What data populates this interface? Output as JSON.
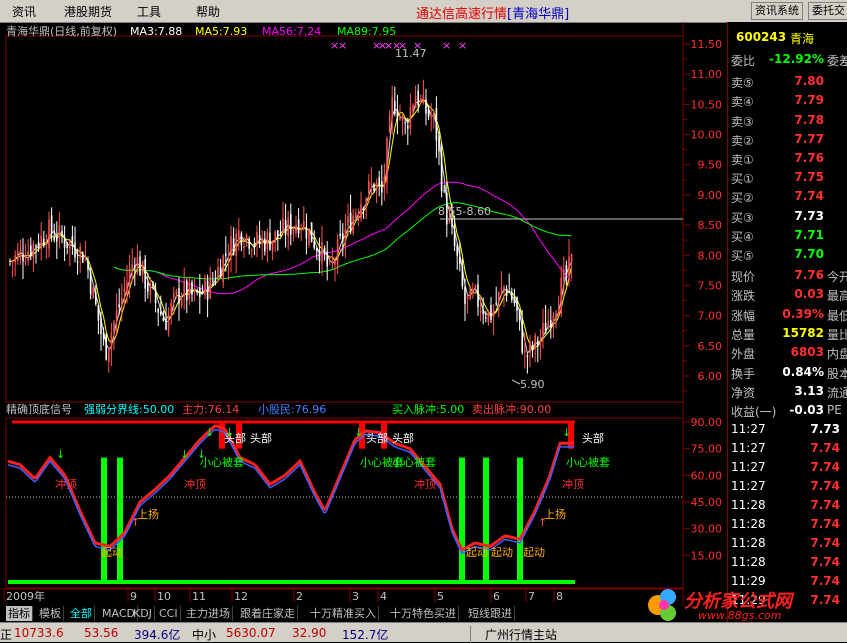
{
  "menu": {
    "items": [
      "资讯",
      "港股期货",
      "工具",
      "帮助"
    ],
    "title": "通达信高速行情",
    "title_stock": "[青海华鼎]",
    "buttons": [
      "资讯系统",
      "委托交"
    ]
  },
  "main_chart": {
    "legend": {
      "name": "青海华鼎(日线,前复权)",
      "ma3": "MA3:7.88",
      "ma5": "MA5:7.93",
      "ma56": "MA56:7.24",
      "ma89": "MA89:7.95"
    },
    "y_ticks": [
      "11.50",
      "11.00",
      "10.50",
      "10.00",
      "9.50",
      "9.00",
      "8.50",
      "8.00",
      "7.50",
      "7.00",
      "6.50",
      "6.00"
    ],
    "annotations": {
      "high": "11.47",
      "low": "5.90",
      "range": "8.55-8.60"
    },
    "colors": {
      "up": "#ff5050",
      "down": "#ffffff",
      "ma3": "#ffffff",
      "ma5": "#ffff00",
      "ma56": "#ff00ff",
      "ma89": "#00ff00"
    }
  },
  "indicator": {
    "legend": {
      "name": "精确顶底信号",
      "strength": "强弱分界线:50.00",
      "main_force": "主力:76.14",
      "retail": "小股民:76.96",
      "buy_pulse": "买入脉冲:5.00",
      "sell_pulse": "卖出脉冲:90.00"
    },
    "y_ticks": [
      "90.00",
      "75.00",
      "60.00",
      "45.00",
      "30.00",
      "15.00"
    ],
    "labels": {
      "top": "头部",
      "caution": "小心被套",
      "rush": "冲顶",
      "rise": "上扬",
      "start": "起动"
    }
  },
  "x_axis": [
    "2009年",
    "9",
    "10",
    "11",
    "12",
    "2",
    "3",
    "4",
    "5",
    "6",
    "7",
    "8"
  ],
  "quote": {
    "code": "600243",
    "name": "青海",
    "ratio_label": "委比",
    "ratio": "-12.92%",
    "ratio_extra": "委差",
    "asks": [
      {
        "label": "卖⑤",
        "price": "7.80"
      },
      {
        "label": "卖④",
        "price": "7.79"
      },
      {
        "label": "卖③",
        "price": "7.78"
      },
      {
        "label": "卖②",
        "price": "7.77"
      },
      {
        "label": "卖①",
        "price": "7.76"
      }
    ],
    "bids": [
      {
        "label": "买①",
        "price": "7.75"
      },
      {
        "label": "买②",
        "price": "7.74"
      },
      {
        "label": "买③",
        "price": "7.73"
      },
      {
        "label": "买④",
        "price": "7.71"
      },
      {
        "label": "买⑤",
        "price": "7.70"
      }
    ],
    "stats": [
      {
        "label": "现价",
        "value": "7.76",
        "extra": "今开"
      },
      {
        "label": "涨跌",
        "value": "0.03",
        "extra": "最高"
      },
      {
        "label": "涨幅",
        "value": "0.39%",
        "extra": "最低"
      },
      {
        "label": "总量",
        "value": "15782",
        "extra": "量比"
      },
      {
        "label": "外盘",
        "value": "6803",
        "extra": "内盘"
      },
      {
        "label": "换手",
        "value": "0.84%",
        "extra": "股本"
      },
      {
        "label": "净资",
        "value": "3.13",
        "extra": "流通"
      },
      {
        "label": "收益(一)",
        "value": "-0.03",
        "extra": "PE"
      }
    ],
    "ticks": [
      {
        "time": "11:27",
        "price": "7.73"
      },
      {
        "time": "11:27",
        "price": "7.74"
      },
      {
        "time": "11:27",
        "price": "7.74"
      },
      {
        "time": "11:27",
        "price": "7.74"
      },
      {
        "time": "11:28",
        "price": "7.74"
      },
      {
        "time": "11:28",
        "price": "7.74"
      },
      {
        "time": "11:28",
        "price": "7.74"
      },
      {
        "time": "11:28",
        "price": "7.74"
      },
      {
        "time": "11:29",
        "price": "7.74"
      },
      {
        "time": "11:29",
        "price": "7.74"
      }
    ]
  },
  "tabs": [
    "指标",
    "模板",
    "全部",
    "MACD",
    "KDJ",
    "CCI",
    "主力进场",
    "跟着庄家走",
    "十万精准买入",
    "十万特色买进",
    "短线跟进"
  ],
  "status": {
    "index1_label": "正",
    "index1": "10733.6",
    "chg1": "53.56",
    "amt1": "394.6亿",
    "index2_label": "中小",
    "index2": "5630.07",
    "chg2": "32.90",
    "amt2": "152.7亿",
    "server": "广州行情主站"
  },
  "watermark": {
    "text": "分析家公式网",
    "url": "www.88gs.com"
  }
}
